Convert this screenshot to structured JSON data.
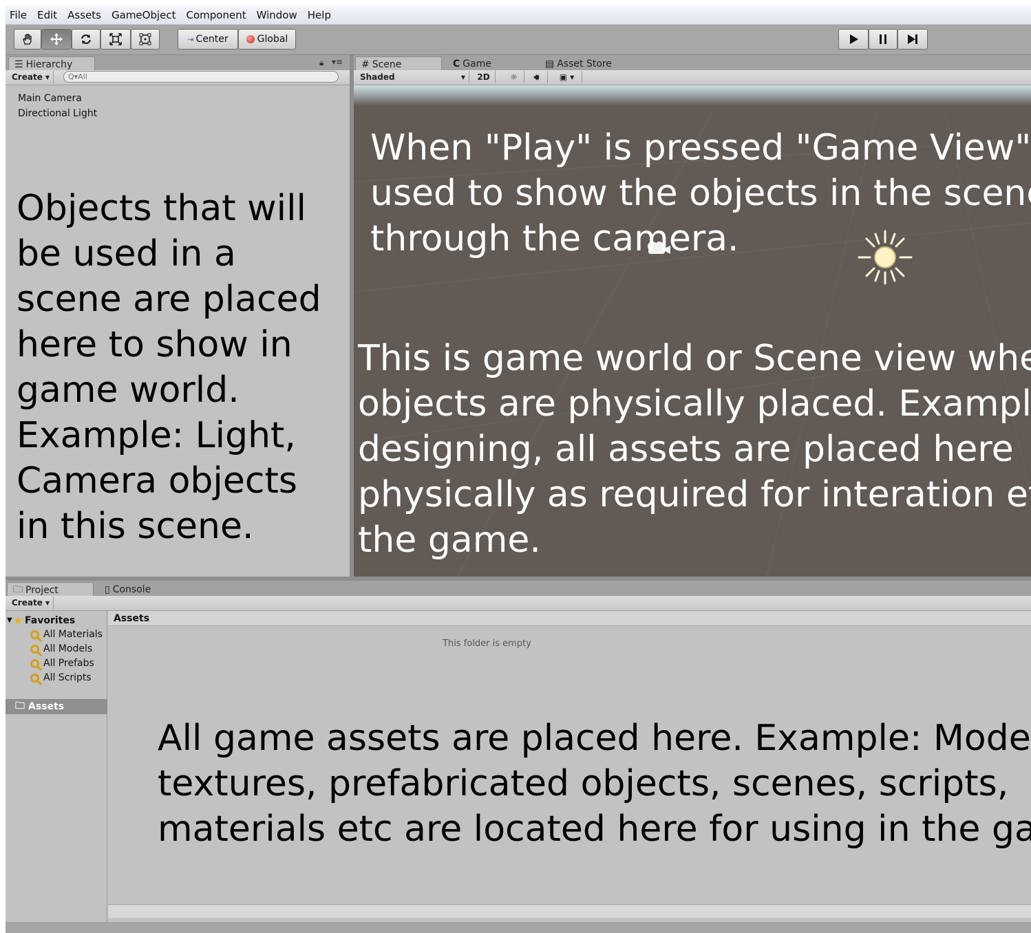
{
  "menu": [
    "File",
    "Edit",
    "Assets",
    "GameObject",
    "Component",
    "Window",
    "Help"
  ],
  "toolbar": {
    "pivot_center": "Center",
    "pivot_global": "Global"
  },
  "hierarchy": {
    "tab_label": "Hierarchy",
    "create_label": "Create",
    "search_placeholder": "Q▾All",
    "items": [
      "Main Camera",
      "Directional Light"
    ],
    "annotation": "Objects that will be used in a scene are placed here to show in game world. Example: Light, Camera objects in this scene."
  },
  "scene_tabs": {
    "scene": "Scene",
    "game": "Game",
    "asset_store": "Asset Store",
    "shading_mode": "Shaded",
    "mode_2d": "2D"
  },
  "scene_view": {
    "annotation_top": "When \"Play\" is pressed \"Game View\" is used to show the objects in the scene through the camera.",
    "annotation_bottom": "This is game world or Scene view where objects are physically placed. Example: For designing, all assets are placed here physically as required for interation etc in the game."
  },
  "project": {
    "tab_project": "Project",
    "tab_console": "Console",
    "create_label": "Create",
    "favorites_label": "Favorites",
    "favorites": [
      "All Materials",
      "All Models",
      "All Prefabs",
      "All Scripts"
    ],
    "assets_folder": "Assets",
    "breadcrumb": "Assets",
    "empty_message": "This folder is empty",
    "annotation": "All game assets are placed here. Example: Models, textures, prefabricated objects, scenes, scripts, materials etc are located here for using in the game."
  },
  "colors": {
    "panel_gray": "#c2c2c2",
    "scene_bg": "#615a55",
    "toolbar_gray": "#a7a7a7",
    "favorites_icon": "#d4a017"
  }
}
